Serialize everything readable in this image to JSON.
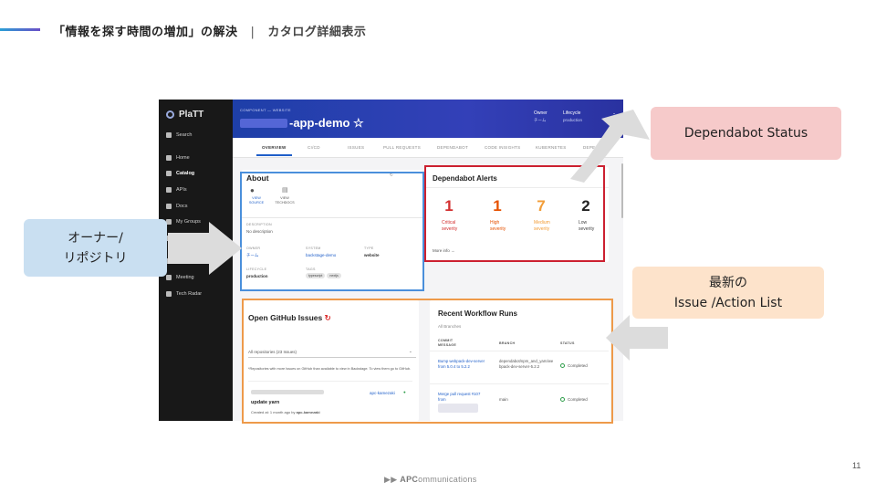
{
  "slide": {
    "title": "「情報を探す時間の増加」の解決",
    "separator": "|",
    "subtitle": "カタログ詳細表示",
    "page_number": "11",
    "footer_arrows": "▶▶",
    "footer_brand_bold": "APC",
    "footer_brand_rest": "ommunications"
  },
  "callouts": {
    "owner_line1": "オーナー/",
    "owner_line2": "リポジトリ",
    "dependabot": "Dependabot Status",
    "issue_line1": "最新の",
    "issue_line2": "Issue /Action List"
  },
  "colors": {
    "owner_callout": "#c9dff1",
    "dependabot_callout": "#f6caca",
    "issue_callout": "#fde3cb",
    "blue_box": "#4a8fdb",
    "red_box": "#cc2030",
    "orange_box": "#ee9a4a"
  },
  "app": {
    "logo": "PlaTT",
    "sidebar": {
      "search": "Search",
      "items": [
        "Home",
        "Catalog",
        "APIs",
        "Docs",
        "My Groups",
        "Gi...",
        "Web",
        "Meeting",
        "Tech Radar"
      ]
    },
    "header": {
      "breadcrumb": "COMPONENT — WEBSITE",
      "title_suffix": "-app-demo ☆",
      "owner_label": "Owner",
      "owner_value": "チーム",
      "lifecycle_label": "Lifecycle",
      "lifecycle_value": "production"
    },
    "tabs": [
      "OVERVIEW",
      "CI/CD",
      "ISSUES",
      "PULL REQUESTS",
      "DEPENDABOT",
      "CODE INSIGHTS",
      "KUBERNETES",
      "DEPENDEN"
    ],
    "about": {
      "title": "About",
      "view_source": "VIEW SOURCE",
      "view_techdocs": "VIEW TECHDOCS",
      "description_label": "DESCRIPTION",
      "description": "No description",
      "owner_label": "OWNER",
      "owner": "チーム",
      "system_label": "SYSTEM",
      "system": "backstage-demo",
      "type_label": "TYPE",
      "type": "website",
      "lifecycle_label": "LIFECYCLE",
      "lifecycle": "production",
      "tags_label": "TAGS",
      "tags": [
        "typescript",
        "nextjs"
      ]
    },
    "dependabot": {
      "title": "Dependabot Alerts",
      "more": "More info →",
      "alerts": [
        {
          "count": "1",
          "label1": "Critical",
          "label2": "severity",
          "color": "#d32f2f"
        },
        {
          "count": "1",
          "label1": "High",
          "label2": "severity",
          "color": "#e65100"
        },
        {
          "count": "7",
          "label1": "Medium",
          "label2": "severity",
          "color": "#f29d38"
        },
        {
          "count": "2",
          "label1": "Low",
          "label2": "severity",
          "color": "#222222"
        }
      ]
    },
    "issues": {
      "title": "Open GitHub Issues",
      "filter": "All repositories (23 Issues)",
      "note": "*Repositories with more Issues on GitHub than available to view in Backstage. To view them go to GitHub.",
      "repo": "apc-kamezaki",
      "issue_title": "update yarn",
      "created": "Created at: 1 month ago by",
      "author": "apc-kamezaki"
    },
    "workflow": {
      "title": "Recent Workflow Runs",
      "subtitle": "All Branches",
      "headers": [
        "COMMIT MESSAGE",
        "BRANCH",
        "STATUS"
      ],
      "rows": [
        {
          "commit": "Bump webpack-dev-server from 5.0.4 to 5.2.2",
          "branch": "dependabot/npm_and_yarn/webpack-dev-server-5.2.2",
          "status": "Completed"
        },
        {
          "commit": "Merge pull request #107 from",
          "branch": "main",
          "status": "Completed"
        }
      ]
    }
  }
}
